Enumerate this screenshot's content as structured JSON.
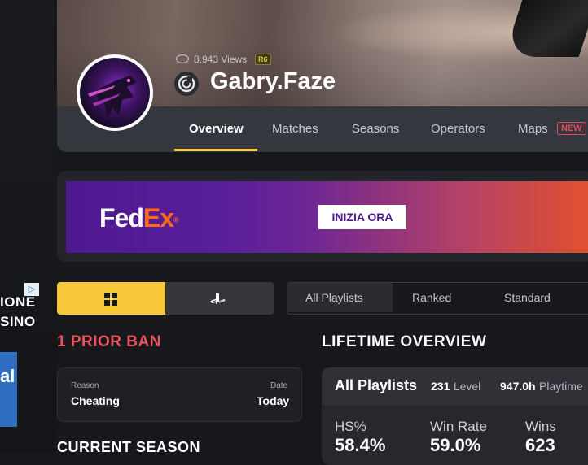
{
  "left_ad": {
    "line1": "IONE",
    "line2": "SINO",
    "adchoices_icon": "ad-choices-icon",
    "blue_ad_text": "al"
  },
  "profile": {
    "views_count": "8.943",
    "views_label": "Views",
    "game_badge": "R6",
    "platform_icon": "ubisoft-icon",
    "username": "Gabry.Faze"
  },
  "nav": {
    "tabs": [
      {
        "label": "Overview",
        "active": true
      },
      {
        "label": "Matches"
      },
      {
        "label": "Seasons"
      },
      {
        "label": "Operators"
      },
      {
        "label": "Maps"
      }
    ],
    "new_badge": "NEW"
  },
  "ad": {
    "brand_fed": "Fed",
    "brand_ex": "Ex",
    "cta": "INIZIA ORA"
  },
  "platforms": {
    "windows_icon": "windows-icon",
    "playstation_icon": "playstation-icon",
    "active": "windows"
  },
  "playlists": [
    "All Playlists",
    "Ranked",
    "Standard"
  ],
  "ban": {
    "title": "1 PRIOR BAN",
    "reason_label": "Reason",
    "reason_value": "Cheating",
    "date_label": "Date",
    "date_value": "Today"
  },
  "current_season": {
    "title": "CURRENT SEASON"
  },
  "lifetime": {
    "title": "LIFETIME OVERVIEW",
    "header": {
      "playlist": "All Playlists",
      "level_value": "231",
      "level_label": "Level",
      "playtime_value": "947.0h",
      "playtime_label": "Playtime"
    },
    "stats": [
      {
        "label": "HS%",
        "value": "58.4%"
      },
      {
        "label": "Win Rate",
        "value": "59.0%"
      },
      {
        "label": "Wins",
        "value": "623"
      }
    ]
  },
  "colors": {
    "accent": "#f7c93a",
    "ban_red": "#e8545f",
    "fedex_purple": "#4d188f",
    "fedex_orange": "#ff6a1a"
  }
}
